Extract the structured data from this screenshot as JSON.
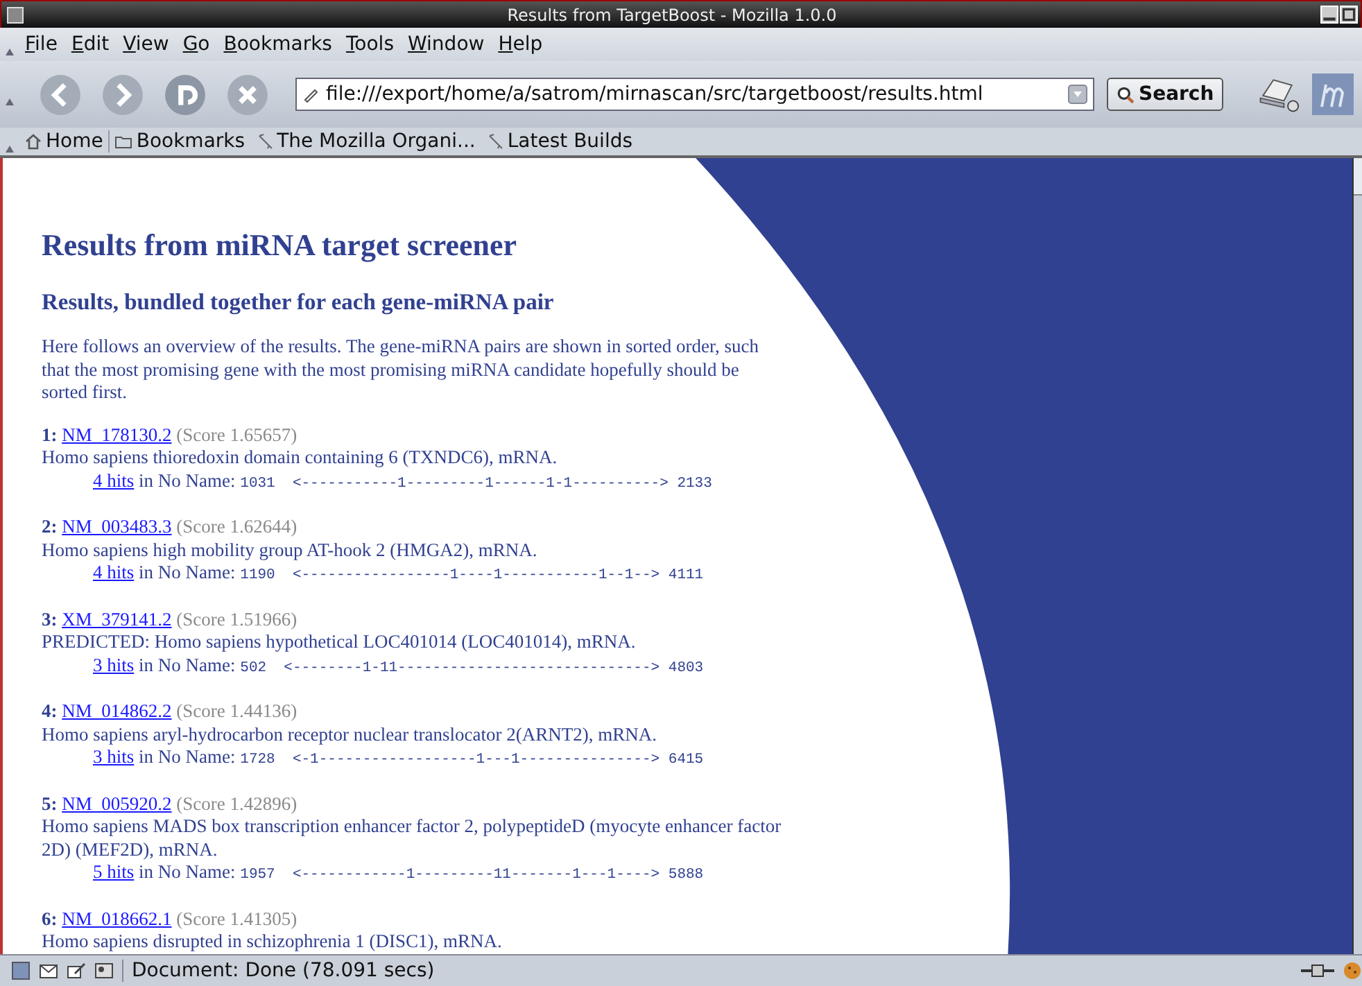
{
  "window": {
    "title": "Results from TargetBoost - Mozilla 1.0.0"
  },
  "menu": [
    "File",
    "Edit",
    "View",
    "Go",
    "Bookmarks",
    "Tools",
    "Window",
    "Help"
  ],
  "toolbar": {
    "url": "file:///export/home/a/satrom/mirnascan/src/targetboost/results.html",
    "search_label": "Search"
  },
  "bookmarks": [
    {
      "kind": "home",
      "label": "Home"
    },
    {
      "kind": "folder",
      "label": "Bookmarks"
    },
    {
      "kind": "link",
      "label": "The Mozilla Organi..."
    },
    {
      "kind": "link",
      "label": "Latest Builds"
    }
  ],
  "page": {
    "title": "Results from miRNA target screener",
    "subtitle": "Results, bundled together for each gene-miRNA pair",
    "intro": "Here follows an overview of the results. The gene-miRNA pairs are shown in sorted order, such that the most promising gene with the most promising miRNA candidate hopefully should be sorted first.",
    "results": [
      {
        "number": "1:",
        "accession": "NM_178130.2",
        "score": "(Score 1.65657)",
        "description": "Homo sapiens thioredoxin domain containing 6 (TXNDC6), mRNA.",
        "hits": "4 hits",
        "source": "in No Name:",
        "start": "1031",
        "track": "<-----------1---------1------1-1---------->",
        "end": "2133"
      },
      {
        "number": "2:",
        "accession": "NM_003483.3",
        "score": "(Score 1.62644)",
        "description": "Homo sapiens high mobility group AT-hook 2 (HMGA2), mRNA.",
        "hits": "4 hits",
        "source": "in No Name:",
        "start": "1190",
        "track": "<-----------------1----1-----------1--1-->",
        "end": "4111"
      },
      {
        "number": "3:",
        "accession": "XM_379141.2",
        "score": "(Score 1.51966)",
        "description": "PREDICTED: Homo sapiens hypothetical LOC401014 (LOC401014), mRNA.",
        "hits": "3 hits",
        "source": "in No Name:",
        "start": "502",
        "track": "<--------1-11----------------------------->",
        "end": "4803"
      },
      {
        "number": "4:",
        "accession": "NM_014862.2",
        "score": "(Score 1.44136)",
        "description": "Homo sapiens aryl-hydrocarbon receptor nuclear translocator 2(ARNT2), mRNA.",
        "hits": "3 hits",
        "source": "in No Name:",
        "start": "1728",
        "track": "<-1------------------1---1--------------->",
        "end": "6415"
      },
      {
        "number": "5:",
        "accession": "NM_005920.2",
        "score": "(Score 1.42896)",
        "description": "Homo sapiens MADS box transcription enhancer factor 2, polypeptideD (myocyte enhancer factor 2D) (MEF2D), mRNA.",
        "hits": "5 hits",
        "source": "in No Name:",
        "start": "1957",
        "track": "<------------1---------11-------1---1---->",
        "end": "5888"
      },
      {
        "number": "6:",
        "accession": "NM_018662.1",
        "score": "(Score 1.41305)",
        "description": "Homo sapiens disrupted in schizophrenia 1 (DISC1), mRNA."
      }
    ]
  },
  "status_bar": {
    "text": "Document: Done (78.091 secs)"
  }
}
